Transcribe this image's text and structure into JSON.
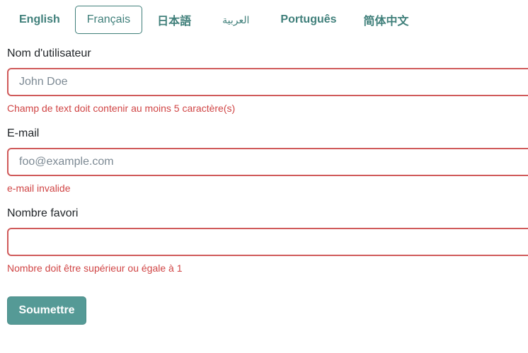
{
  "languages": {
    "items": [
      {
        "label": "English",
        "active": false
      },
      {
        "label": "Français",
        "active": true
      },
      {
        "label": "日本語",
        "active": false
      },
      {
        "label": "العربية",
        "active": false
      },
      {
        "label": "Português",
        "active": false
      },
      {
        "label": "简体中文",
        "active": false
      }
    ]
  },
  "form": {
    "username": {
      "label": "Nom d'utilisateur",
      "value": "",
      "placeholder": "John Doe",
      "error": "Champ de text doit contenir au moins 5 caractère(s)"
    },
    "email": {
      "label": "E-mail",
      "value": "",
      "placeholder": "foo@example.com",
      "error": "e-mail invalide"
    },
    "favorite_number": {
      "label": "Nombre favori",
      "value": "",
      "placeholder": "",
      "error": "Nombre doit être supérieur ou égale à 1"
    },
    "submit_label": "Soumettre"
  },
  "colors": {
    "accent": "#3f7f7a",
    "button": "#559a96",
    "error": "#d04545",
    "error_border": "#d05a5a"
  }
}
